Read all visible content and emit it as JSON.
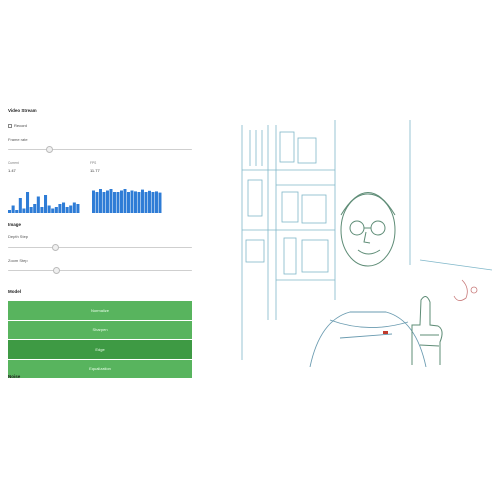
{
  "video_stream": {
    "title": "Video Stream",
    "checkbox_label": "Record",
    "frame_rate_label": "Frame rate",
    "stat_left_label": "Current",
    "stat_left_value": "1.47",
    "stat_right_label": "FPS",
    "stat_right_value": "11.77",
    "hist_left_values": [
      0.1,
      0.25,
      0.1,
      0.5,
      0.15,
      0.7,
      0.2,
      0.3,
      0.55,
      0.2,
      0.6,
      0.25,
      0.15,
      0.2,
      0.3,
      0.35,
      0.2,
      0.25,
      0.35,
      0.3
    ],
    "hist_right_values": [
      0.75,
      0.7,
      0.8,
      0.7,
      0.75,
      0.8,
      0.7,
      0.7,
      0.75,
      0.8,
      0.7,
      0.75,
      0.72,
      0.7,
      0.78,
      0.7,
      0.74,
      0.7,
      0.72,
      0.68
    ],
    "chart_color": "#2e7cd6"
  },
  "image": {
    "title": "Image",
    "slider1_label": "Depth Step",
    "slider2_label": "Zoom Step"
  },
  "model": {
    "title": "Model",
    "buttons": [
      "Normalize",
      "Sharpen",
      "Edge",
      "Equalization"
    ],
    "active_index": 2,
    "button_color": "#58b45e"
  },
  "footer": {
    "title": "Noise"
  }
}
